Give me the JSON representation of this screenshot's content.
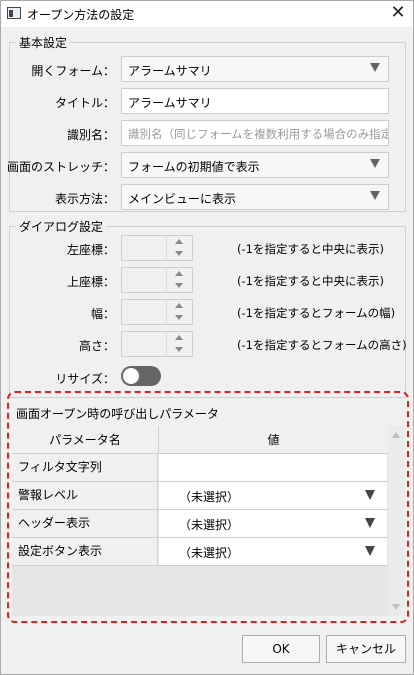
{
  "window": {
    "title": "オープン方法の設定",
    "close_glyph": "✕"
  },
  "basic": {
    "group_label": "基本設定",
    "open_form": {
      "label": "開くフォーム：",
      "value": "アラームサマリ"
    },
    "title": {
      "label": "タイトル：",
      "value": "アラームサマリ"
    },
    "identifier": {
      "label": "識別名：",
      "placeholder": "識別名（同じフォームを複数利用する場合のみ指定）"
    },
    "stretch": {
      "label": "画面のストレッチ：",
      "value": "フォームの初期値で表示"
    },
    "display_method": {
      "label": "表示方法：",
      "value": "メインビューに表示"
    }
  },
  "dialog": {
    "group_label": "ダイアログ設定",
    "left": {
      "label": "左座標：",
      "hint": "(-1を指定すると中央に表示)"
    },
    "top": {
      "label": "上座標：",
      "hint": "(-1を指定すると中央に表示)"
    },
    "width": {
      "label": "幅：",
      "hint": "(-1を指定するとフォームの幅)"
    },
    "height": {
      "label": "高さ：",
      "hint": "(-1を指定するとフォームの高さ)"
    },
    "resize": {
      "label": "リサイズ：",
      "on": false
    }
  },
  "params": {
    "group_label": "画面オープン時の呼び出しパラメータ",
    "columns": [
      "パラメータ名",
      "値"
    ],
    "rows": [
      {
        "name": "フィルタ文字列",
        "value": "",
        "dropdown": false
      },
      {
        "name": "警報レベル",
        "value": "（未選択）",
        "dropdown": true
      },
      {
        "name": "ヘッダー表示",
        "value": "（未選択）",
        "dropdown": true
      },
      {
        "name": "設定ボタン表示",
        "value": "（未選択）",
        "dropdown": true
      }
    ]
  },
  "buttons": {
    "ok": "OK",
    "cancel": "キャンセル"
  },
  "colors": {
    "highlight_outline": "#e02020",
    "toggle_off": "#666666"
  }
}
